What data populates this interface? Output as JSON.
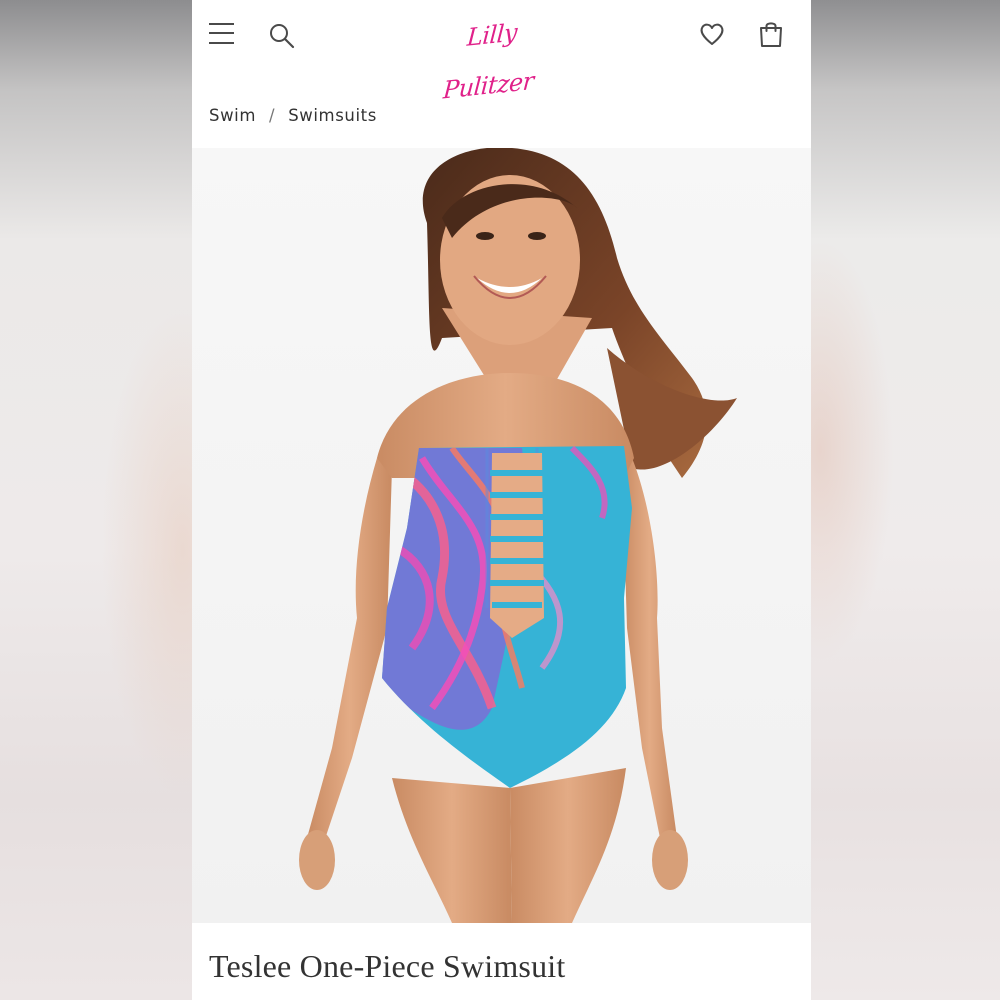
{
  "header": {
    "menu_icon": "hamburger-menu-icon",
    "search_icon": "search-icon",
    "logo_text": "Lilly Pulitzer",
    "wishlist_icon": "heart-icon",
    "bag_icon": "shopping-bag-icon"
  },
  "breadcrumb": {
    "items": [
      "Swim",
      "Swimsuits"
    ],
    "separator": "/"
  },
  "product": {
    "title": "Teslee One-Piece Swimsuit"
  },
  "colors": {
    "brand": "#e0218a",
    "swimsuit_base": "#36b3d6",
    "swimsuit_print": "#e84fb6",
    "text": "#333333"
  }
}
